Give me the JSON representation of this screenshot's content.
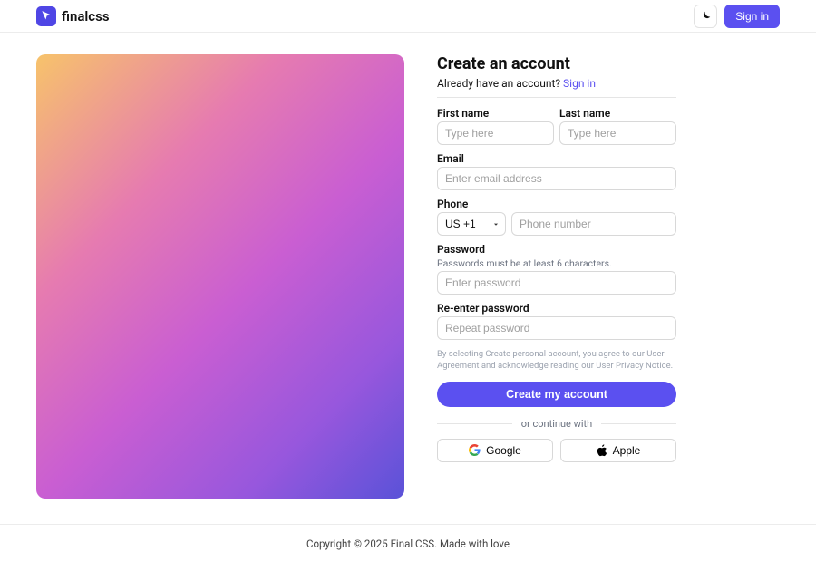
{
  "header": {
    "brand": "finalcss",
    "sign_in_label": "Sign in"
  },
  "form": {
    "title": "Create an account",
    "subtitle_prefix": "Already have an account? ",
    "subtitle_link": "Sign in",
    "first_name": {
      "label": "First name",
      "placeholder": "Type here"
    },
    "last_name": {
      "label": "Last name",
      "placeholder": "Type here"
    },
    "email": {
      "label": "Email",
      "placeholder": "Enter email address"
    },
    "phone": {
      "label": "Phone",
      "country_code": "US +1",
      "placeholder": "Phone number"
    },
    "password": {
      "label": "Password",
      "helper": "Passwords must be at least 6 characters.",
      "placeholder": "Enter password"
    },
    "password_confirm": {
      "label": "Re-enter password",
      "placeholder": "Repeat password"
    },
    "terms": "By selecting Create personal account, you agree to our User Agreement and acknowledge reading our User Privacy Notice.",
    "submit_label": "Create my account",
    "divider_label": "or continue with",
    "oauth": {
      "google": "Google",
      "apple": "Apple"
    }
  },
  "footer": {
    "text": "Copyright © 2025 Final CSS. Made with love"
  }
}
